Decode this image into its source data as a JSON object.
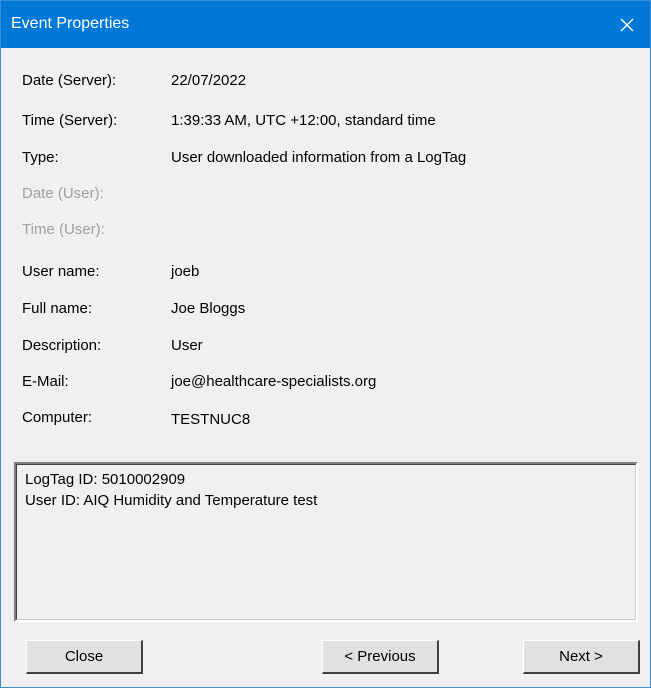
{
  "window": {
    "title": "Event Properties"
  },
  "fields": [
    {
      "label": "Date (Server):",
      "value": "22/07/2022"
    },
    {
      "label": "Time (Server):",
      "value": "1:39:33 AM, UTC +12:00, standard time"
    },
    {
      "label": "Type:",
      "value": "User downloaded information from a LogTag"
    },
    {
      "label": "Date (User):",
      "value": ""
    },
    {
      "label": "Time (User):",
      "value": ""
    },
    {
      "label": "User name:",
      "value": "joeb"
    },
    {
      "label": "Full name:",
      "value": "Joe Bloggs"
    },
    {
      "label": "Description:",
      "value": "User"
    },
    {
      "label": "E-Mail:",
      "value": "joe@healthcare-specialists.org"
    },
    {
      "label": "Computer:",
      "value": "TESTNUC8"
    }
  ],
  "details": {
    "lines": [
      "LogTag ID: 5010002909",
      "User ID: AIQ Humidity and Temperature test"
    ]
  },
  "buttons": {
    "close": "Close",
    "previous": "< Previous",
    "next": "Next >"
  },
  "icons": {
    "close": "close-icon"
  }
}
